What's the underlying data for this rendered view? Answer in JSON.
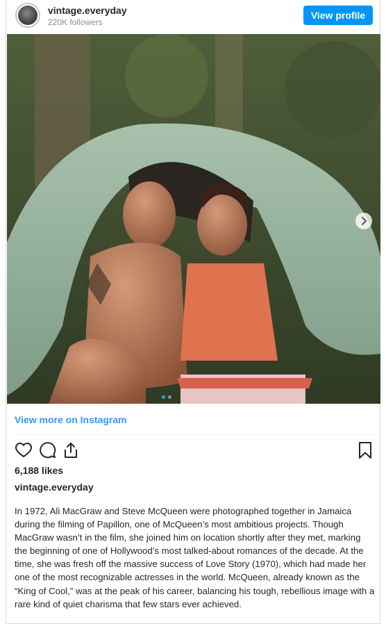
{
  "header": {
    "username": "vintage.everyday",
    "followers": "220K followers",
    "view_profile_label": "View profile",
    "avatar_icon": "profile-avatar"
  },
  "post": {
    "image_description_icon": "photo",
    "carousel": {
      "current": 1,
      "total": 2
    },
    "view_more_label": "View more on Instagram"
  },
  "actions": {
    "like_icon": "heart-icon",
    "comment_icon": "comment-icon",
    "share_icon": "share-icon",
    "save_icon": "bookmark-icon"
  },
  "likes_text": "6,188 likes",
  "caption": {
    "username": "vintage.everyday",
    "text": "In 1972, Ali MacGraw and Steve McQueen were photographed together in Jamaica during the filming of Papillon, one of McQueen’s most ambitious projects. Though MacGraw wasn’t in the film, she joined him on location shortly after they met, marking the beginning of one of Hollywood’s most talked-about romances of the decade. At the time, she was fresh off the massive success of Love Story (1970), which had made her one of the most recognizable actresses in the world. McQueen, already known as the “King of Cool,” was at the peak of his career, balancing his tough, rebellious image with a rare kind of quiet charisma that few stars ever achieved."
  },
  "colors": {
    "accent": "#0095f6",
    "link": "#3897f0",
    "text": "#262626",
    "muted": "#8e8e8e"
  }
}
